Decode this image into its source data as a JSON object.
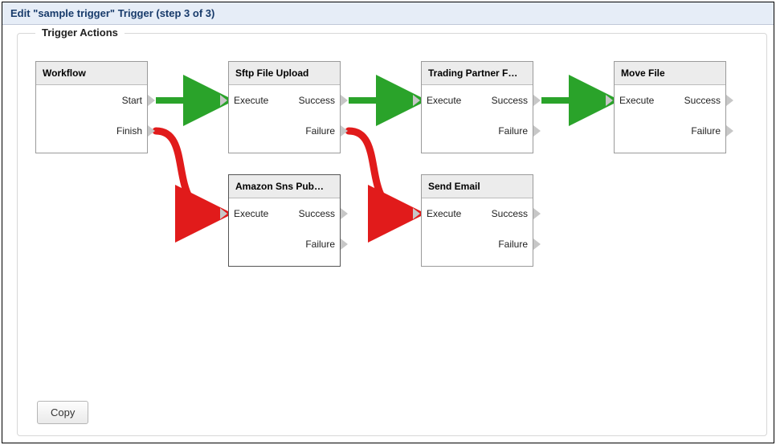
{
  "header": {
    "title": "Edit \"sample trigger\" Trigger (step 3 of 3)"
  },
  "panel": {
    "title": "Trigger Actions"
  },
  "portLabels": {
    "start": "Start",
    "finish": "Finish",
    "execute": "Execute",
    "success": "Success",
    "failure": "Failure"
  },
  "nodes": {
    "workflow": {
      "title": "Workflow"
    },
    "sftp": {
      "title": "Sftp File Upload"
    },
    "trading": {
      "title": "Trading Partner F…"
    },
    "move": {
      "title": "Move File"
    },
    "sns": {
      "title": "Amazon Sns Pub…"
    },
    "email": {
      "title": "Send Email"
    }
  },
  "buttons": {
    "copy": "Copy"
  },
  "edges": [
    {
      "from": "workflow.start",
      "to": "sftp.execute",
      "kind": "success"
    },
    {
      "from": "sftp.success",
      "to": "trading.execute",
      "kind": "success"
    },
    {
      "from": "trading.success",
      "to": "move.execute",
      "kind": "success"
    },
    {
      "from": "workflow.finish",
      "to": "sns.execute",
      "kind": "failure"
    },
    {
      "from": "sftp.failure",
      "to": "email.execute",
      "kind": "failure"
    }
  ],
  "colors": {
    "success": "#2aa32a",
    "failure": "#e11b1b",
    "arrowhead": "#c7c7c7"
  }
}
